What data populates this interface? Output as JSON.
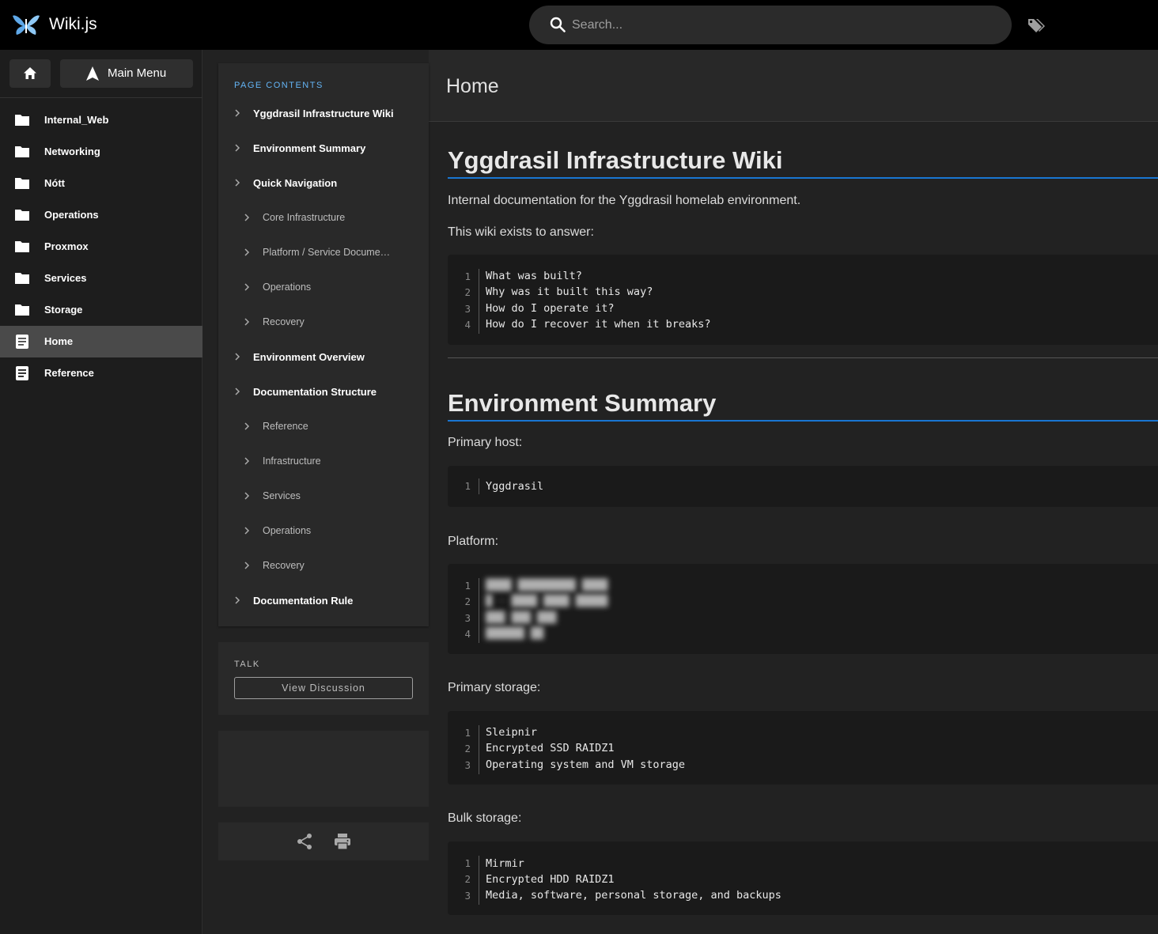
{
  "app": {
    "title": "Wiki.js"
  },
  "search": {
    "placeholder": "Search..."
  },
  "sidebar": {
    "main_menu_label": "Main Menu",
    "items": [
      {
        "label": "Internal_Web",
        "icon": "folder-icon"
      },
      {
        "label": "Networking",
        "icon": "folder-icon"
      },
      {
        "label": "Nótt",
        "icon": "folder-icon"
      },
      {
        "label": "Operations",
        "icon": "folder-icon"
      },
      {
        "label": "Proxmox",
        "icon": "folder-icon"
      },
      {
        "label": "Services",
        "icon": "folder-icon"
      },
      {
        "label": "Storage",
        "icon": "folder-icon"
      },
      {
        "label": "Home",
        "icon": "page-icon",
        "active": true
      },
      {
        "label": "Reference",
        "icon": "page-icon"
      }
    ]
  },
  "toc": {
    "heading": "PAGE CONTENTS",
    "items": [
      {
        "label": "Yggdrasil Infrastructure Wiki",
        "level": 1
      },
      {
        "label": "Environment Summary",
        "level": 1
      },
      {
        "label": "Quick Navigation",
        "level": 1
      },
      {
        "label": "Core Infrastructure",
        "level": 2
      },
      {
        "label": "Platform / Service Documentation",
        "level": 2
      },
      {
        "label": "Operations",
        "level": 2
      },
      {
        "label": "Recovery",
        "level": 2
      },
      {
        "label": "Environment Overview",
        "level": 1
      },
      {
        "label": "Documentation Structure",
        "level": 1
      },
      {
        "label": "Reference",
        "level": 2
      },
      {
        "label": "Infrastructure",
        "level": 2
      },
      {
        "label": "Services",
        "level": 2
      },
      {
        "label": "Operations",
        "level": 2
      },
      {
        "label": "Recovery",
        "level": 2
      },
      {
        "label": "Documentation Rule",
        "level": 1
      }
    ]
  },
  "talk": {
    "heading": "TALK",
    "button": "View Discussion"
  },
  "page": {
    "title": "Home",
    "h1_main": "Yggdrasil Infrastructure Wiki",
    "intro": "Internal documentation for the Yggdrasil homelab environment.",
    "exists_label": "This wiki exists to answer:",
    "questions": [
      "What was built?",
      "Why was it built this way?",
      "How do I operate it?",
      "How do I recover it when it breaks?"
    ],
    "h1_env": "Environment Summary",
    "primary_host_label": "Primary host:",
    "primary_host": [
      "Yggdrasil"
    ],
    "platform_label": "Platform:",
    "platform_lines": [
      "████ █████████ ████",
      "█ · ████ ████ █████",
      "███ ███ ███",
      "██████ ██"
    ],
    "primary_storage_label": "Primary storage:",
    "primary_storage": [
      "Sleipnir",
      "Encrypted SSD RAIDZ1",
      "Operating system and VM storage"
    ],
    "bulk_storage_label": "Bulk storage:",
    "bulk_storage": [
      "Mirmir",
      "Encrypted HDD RAIDZ1",
      "Media, software, personal storage, and backups"
    ]
  }
}
